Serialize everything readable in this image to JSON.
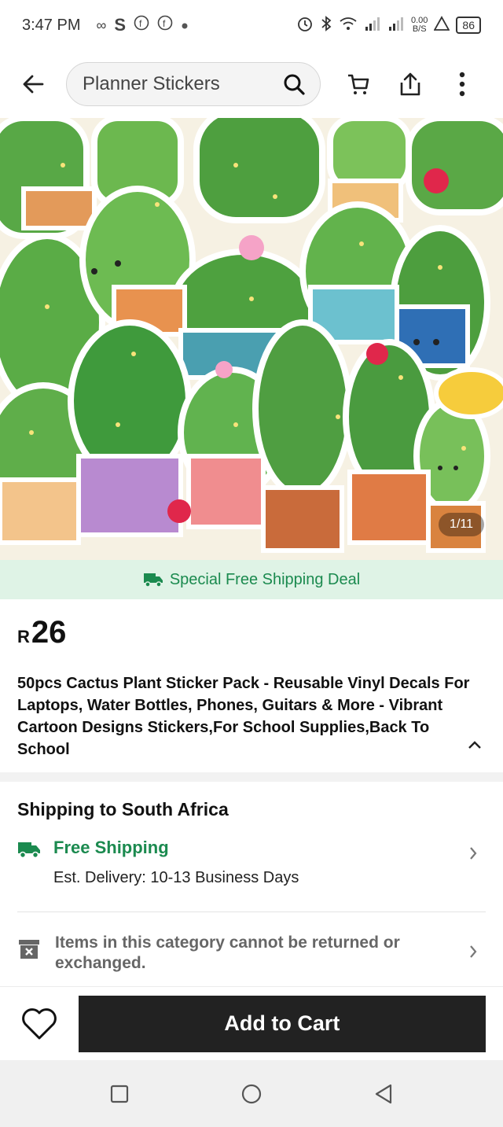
{
  "status_bar": {
    "time": "3:47 PM",
    "net_speed_value": "0.00",
    "net_speed_unit": "B/S",
    "battery": "86",
    "left_icons": [
      "infinity-icon",
      "s-icon",
      "facebook-icon",
      "facebook-icon",
      "dot-icon"
    ],
    "right_icons": [
      "alarm-icon",
      "bluetooth-icon",
      "wifi-icon",
      "signal-icon",
      "signal-icon",
      "alert-icon"
    ]
  },
  "nav": {
    "search_text": "Planner Stickers"
  },
  "product_image": {
    "counter": "1/11",
    "description_icon": "cactus-sticker-image"
  },
  "banner": {
    "text": "Special Free Shipping Deal",
    "color": "#1b8a4f"
  },
  "product": {
    "currency": "R",
    "price": "26",
    "title": "50pcs Cactus Plant Sticker Pack - Reusable Vinyl Decals For Laptops, Water Bottles, Phones, Guitars & More - Vibrant Cartoon Designs Stickers,For School Supplies,Back To School"
  },
  "shipping": {
    "heading": "Shipping to South Africa",
    "free_label": "Free Shipping",
    "estimate": "Est. Delivery: 10-13 Business Days",
    "return_policy": "Items in this category cannot be returned or exchanged."
  },
  "bottom_bar": {
    "add_to_cart": "Add to Cart"
  },
  "colors": {
    "accent_green": "#1b8a4f",
    "banner_bg": "#dff3e6",
    "cart_button": "#222222"
  }
}
